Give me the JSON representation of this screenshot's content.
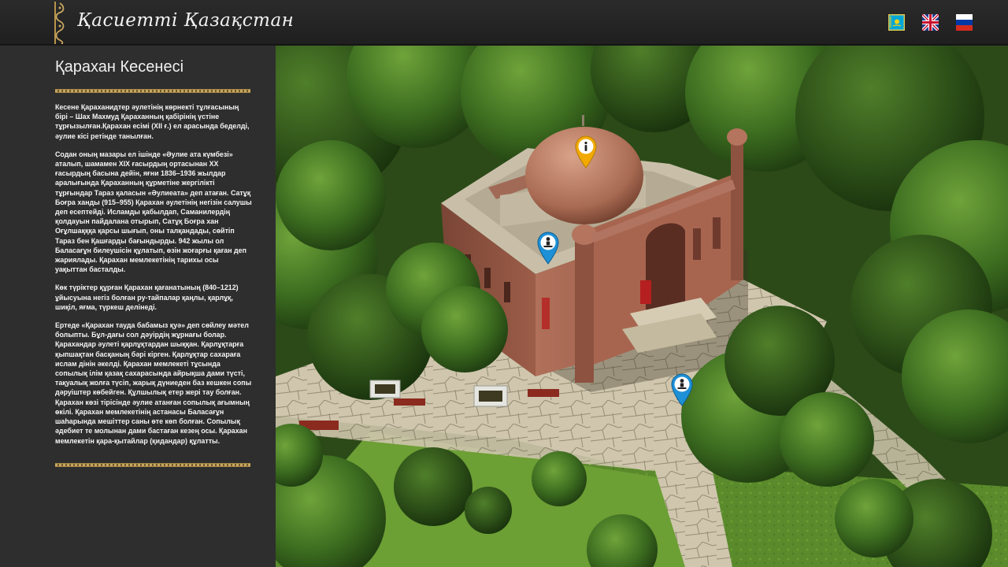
{
  "header": {
    "logo_text": "Қасиетті Қазақстан",
    "languages": [
      {
        "code": "kk",
        "icon": "kazakhstan-flag-icon"
      },
      {
        "code": "en",
        "icon": "uk-flag-icon"
      },
      {
        "code": "ru",
        "icon": "russia-flag-icon"
      }
    ]
  },
  "sidebar": {
    "title": "Қарахан Кесенесі",
    "paragraphs": [
      "Кесене Қараханидтер әулетінің көрнекті тұлғасының бірі – Шах Махмуд Қараханның қабірінің үстіне тұрғызылған.Қарахан есімі (XII ғ.) ел арасында беделді, әулие кісі ретінде танылған.",
      "Содан оның мазары ел ішінде «Әулие ата күмбезі» аталып, шамамен XIX ғасырдың ортасынан XX ғасырдың басына дейін, яғни  1836–1936 жылдар аралығында Қарахан­ның құрметіне жергілікті тұрғындар Тараз қаласын «Әулиеата» деп атаған. Сатұқ Боғра ханды (915–955) Қарахан әулетінің негізін салушы деп есептейді. Исламды қабылдап, Саманилердің қолдауын пайдалана отырып, Сатұқ Боғра хан Оғұлшақққа қарсы шығып, оны талқандады, сөйтіп Тараз бен Қашғарды бағындырды. 942 жылы ол Баласағұн билеушісін құлатып, өзін жоғарғы қаған деп жариялады. Қарахан мемлекетінің тарихы осы уақыттан басталды.",
      "Көк түріктер құрған Қарахан қағанатының (840–1212) ұйысуына негіз болған ру-тайпалар қаңлы, қарлұқ, шиқіл, яғма, түркеш делінеді.",
      "Ертеде «Қарахан тауда бабамыз қуә» деп сөйлеу мәтел болыпты. Бұл-дағы сол дәуірдің жұрнағы болар. Қарахандар әулеті қарлұқтардан шыққан. Қарлұқтарға қыпшақтан басқаның бәрі кірген. Қарлұқтар сахараға ислам дінін әкелді. Қарахан мемлекеті тұсында сопылық ілім қазақ сахарасында айрықша дами түсті, тақуалық жолға түсіп, жарық дүниеден баз кешкен сопы дәруіштер көбейген. Құлшылық етер жері тау болған. Қарахан көзі тірісінде әулие атанған сопылық ағымның өкілі.  Қарахан мемлекетінің астанасы Баласағұн шаһарында мешіттер саны өте көп болған. Сопылық әдебиет те молынан дами бастаған кезең осы. Қарахан мемлекетін қара-қытайлар (қидандар) құлатты."
    ]
  },
  "scene": {
    "pins": [
      {
        "name": "info-pin",
        "icon": "info-icon",
        "color": "#f2a900"
      },
      {
        "name": "person-pin-roof",
        "icon": "person-icon",
        "color": "#1e90d6"
      },
      {
        "name": "person-pin-path",
        "icon": "person-icon",
        "color": "#1e90d6"
      }
    ]
  },
  "colors": {
    "header_bg": "#252525",
    "sidebar_bg": "#2e2e2e",
    "ornament_gold": "#c9a760"
  }
}
